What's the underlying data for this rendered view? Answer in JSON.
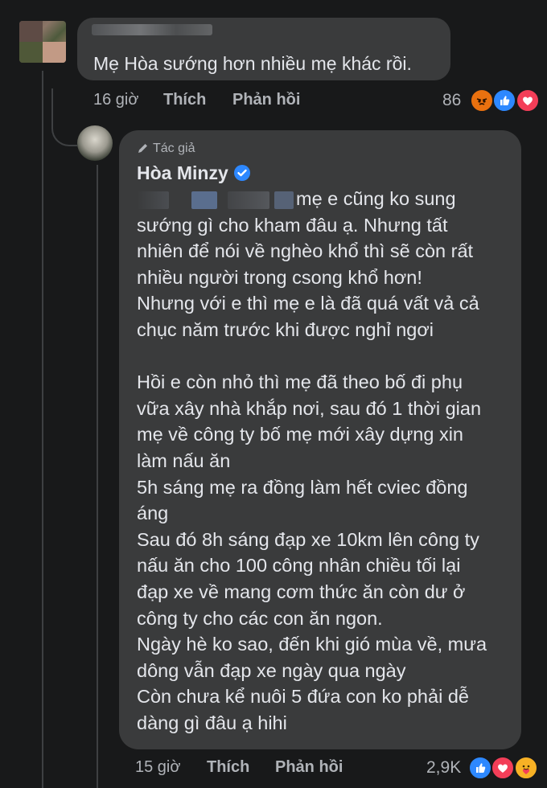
{
  "comment1": {
    "text": "Mẹ Hòa sướng hơn nhiều mẹ khác rồi.",
    "time": "16 giờ",
    "like_label": "Thích",
    "reply_label": "Phản hồi",
    "reaction_count": "86",
    "reactions": [
      "angry-icon",
      "like-icon",
      "love-icon"
    ]
  },
  "reply": {
    "author_badge": "Tác giả",
    "author_name": "Hòa Minzy",
    "lines": [
      "mẹ e cũng ko sung",
      "sướng gì cho kham đâu ạ. Nhưng tất",
      "nhiên để nói về nghèo khổ thì sẽ còn rất",
      "nhiều người trong csong khổ hơn!",
      "Nhưng với e thì mẹ e là đã quá vất vả cả",
      "chục năm trước khi được nghỉ ngơi",
      "",
      "Hồi e còn nhỏ thì mẹ đã theo bố đi phụ",
      "vữa xây nhà khắp nơi, sau đó 1 thời gian",
      "mẹ về công ty bố mẹ mới xây dựng xin",
      "làm nấu ăn",
      "5h sáng mẹ ra đồng làm hết cviec đồng",
      "áng",
      "Sau đó 8h sáng đạp xe 10km lên công ty",
      "nấu ăn cho 100 công nhân chiều tối lại",
      "đạp xe về mang cơm thức ăn còn dư ở",
      "công ty cho các con ăn ngon.",
      "Ngày hè ko sao, đến khi gió mùa về, mưa",
      "dông vẫn đạp xe ngày qua ngày",
      "Còn chưa kể nuôi 5 đứa con ko phải dễ",
      "dàng gì đâu ạ hihi"
    ],
    "time": "15 giờ",
    "like_label": "Thích",
    "reply_label": "Phản hồi",
    "reaction_count": "2,9K",
    "reactions": [
      "like-icon",
      "love-icon",
      "care-icon"
    ]
  },
  "colors": {
    "background": "#18191a",
    "bubble": "#3a3b3c",
    "text": "#e4e6eb",
    "meta": "#b0b3b8",
    "like_blue": "#2d88ff",
    "love_red": "#f33e58",
    "angry_orange": "#e9710f"
  }
}
